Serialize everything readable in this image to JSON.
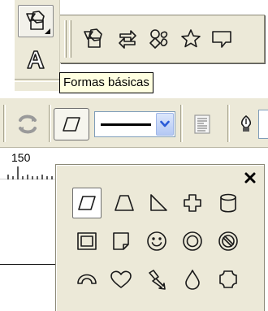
{
  "tooltip": {
    "text": "Formas básicas"
  },
  "ruler": {
    "label": "150"
  },
  "toolbox": {
    "tools": [
      {
        "name": "basic-shapes-tool",
        "icon": "basic-shapes-icon",
        "pressed": true,
        "has_flyout": true
      },
      {
        "name": "text-tool",
        "icon": "text-a-icon",
        "pressed": false,
        "has_flyout": true
      }
    ]
  },
  "flyout": {
    "buttons": [
      {
        "name": "basic-shapes",
        "icon": "basic-shapes-icon"
      },
      {
        "name": "arrow-shapes",
        "icon": "arrow-shapes-icon"
      },
      {
        "name": "flowchart-shapes",
        "icon": "flowchart-shapes-icon"
      },
      {
        "name": "star-shapes",
        "icon": "star-icon"
      },
      {
        "name": "callout-shapes",
        "icon": "callout-icon"
      }
    ]
  },
  "property_bar": {
    "items": [
      {
        "name": "rotate-mirror",
        "icon": "rotate-icon"
      },
      {
        "name": "perfect-shape-picker",
        "icon": "parallelogram-icon"
      },
      {
        "name": "outline-style",
        "icon": "line-style-icon"
      },
      {
        "name": "wrap-text",
        "icon": "wrap-text-icon"
      },
      {
        "name": "outline-pen",
        "icon": "pen-nib-icon"
      }
    ]
  },
  "palette": {
    "close_icon": "close-icon",
    "selected": "parallelogram",
    "shapes": [
      [
        "parallelogram",
        "trapezoid",
        "right-triangle",
        "cross",
        "cylinder"
      ],
      [
        "frame",
        "folded-corner",
        "smiley",
        "donut",
        "no-symbol"
      ],
      [
        "arc",
        "heart",
        "lightning",
        "teardrop",
        "plaque"
      ]
    ]
  },
  "colors": {
    "toolbar_bg": "#ece9d8",
    "tooltip_bg": "#ffffe1",
    "dropdown_accent": "#2a5bd7"
  }
}
